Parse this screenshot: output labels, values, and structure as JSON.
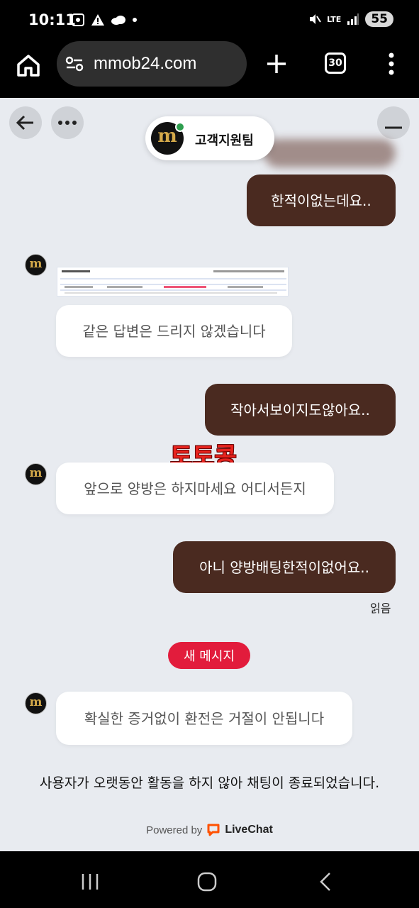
{
  "status_bar": {
    "time": "10:11",
    "network": "LTE",
    "battery": "55"
  },
  "browser": {
    "url": "mmob24.com",
    "tab_count": "30"
  },
  "chat": {
    "agent_name": "고객지원팀",
    "agent_logo_letter": "m",
    "messages": [
      {
        "from": "user",
        "text": "한적이없는데요.."
      },
      {
        "from": "agent",
        "text": "같은 답변은 드리지 않겠습니다"
      },
      {
        "from": "user",
        "text": "작아서보이지도않아요.."
      },
      {
        "from": "agent",
        "text": "앞으로 양방은 하지마세요 어디서든지"
      },
      {
        "from": "user",
        "text": "아니 양방배팅한적이없어요.."
      },
      {
        "from": "agent",
        "text": "확실한 증거없이 환전은 거절이 안됩니다"
      }
    ],
    "watermark": "토토콩",
    "read_label": "읽음",
    "new_message_badge": "새 메시지",
    "ended_notice": "사용자가 오랫동안 활동을 하지 않아 채팅이 종료되었습니다.",
    "powered_by": "Powered by",
    "brand": "LiveChat"
  },
  "colors": {
    "user_bubble": "#4a2a20",
    "agent_bubble": "#ffffff",
    "chat_bg": "#e8ebf0",
    "badge": "#e21c3c",
    "online": "#2e9e4f"
  }
}
